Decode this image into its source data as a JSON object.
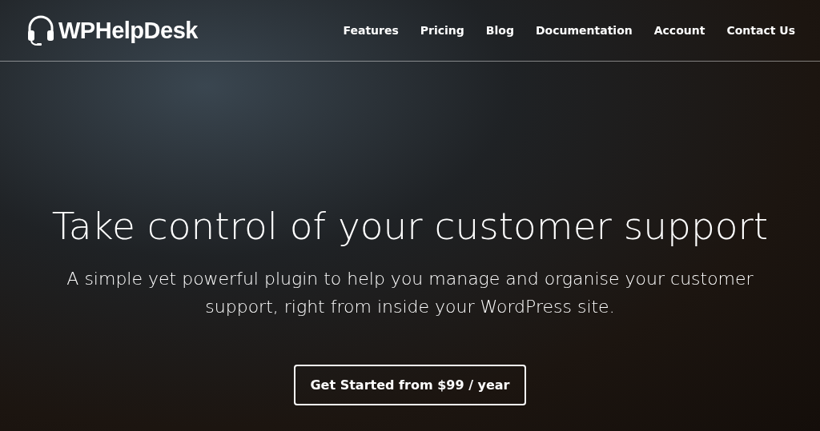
{
  "header": {
    "logo": "WPHelpDesk",
    "nav": [
      "Features",
      "Pricing",
      "Blog",
      "Documentation",
      "Account",
      "Contact Us"
    ]
  },
  "hero": {
    "title": "Take control of your customer support",
    "subtitle": "A simple yet powerful plugin to help you manage and organise your customer support, right from inside your WordPress site.",
    "cta": "Get Started from $99 / year"
  }
}
